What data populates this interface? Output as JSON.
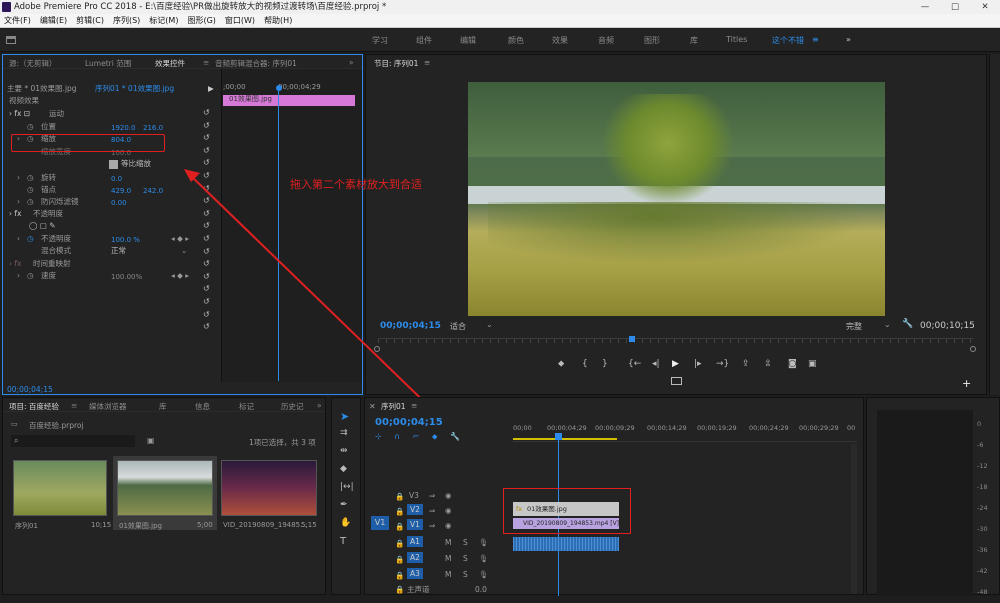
{
  "window": {
    "title": "Adobe Premiere Pro CC 2018 - E:\\百度经验\\PR做出旋转放大的视频过渡转场\\百度经验.prproj *",
    "controls": [
      "—",
      "□",
      "✕"
    ]
  },
  "menu": [
    "文件(F)",
    "编辑(E)",
    "剪辑(C)",
    "序列(S)",
    "标记(M)",
    "图形(G)",
    "窗口(W)",
    "帮助(H)"
  ],
  "workspaces": [
    "学习",
    "组件",
    "编辑",
    "颜色",
    "效果",
    "音频",
    "图形",
    "库",
    "Titles",
    "这个不错",
    "»"
  ],
  "effect_controls": {
    "tabs": [
      "源:（无剪辑）",
      "Lumetri 范围",
      "效果控件",
      "音频剪辑混合器: 序列01"
    ],
    "master": "主要 * 01效果图.jpg",
    "sequence_clip": "序列01 * 01效果图.jpg",
    "timecode_start": ";00;00",
    "timecode_mid": "00;00;04;29",
    "clip_name": "01效果图.jpg",
    "video_effects": "视频效果",
    "motion": "运动",
    "position": "位置",
    "pos_x": "1920.0",
    "pos_y": "216.0",
    "scale": "缩放",
    "scale_val": "804.0",
    "scale_width": "缩放宽度",
    "scale_width_val": "100.0",
    "uniform": "等比缩放",
    "rotation": "旋转",
    "rotation_val": "0.0",
    "anchor": "锚点",
    "anchor_x": "429.0",
    "anchor_y": "242.0",
    "flicker": "防闪烁滤镜",
    "flicker_val": "0.00",
    "opacity_group": "不透明度",
    "opacity": "不透明度",
    "opacity_val": "100.0 %",
    "blend": "混合模式",
    "blend_val": "正常",
    "time_remap": "时间重映射",
    "speed": "速度",
    "speed_val": "100.00%",
    "footer_tc": "00;00;04;15"
  },
  "annotation": {
    "text": "拖入第二个素材放大到合适"
  },
  "program": {
    "title": "节目: 序列01",
    "timecode": "00;00;04;15",
    "fit": "适合",
    "quality": "完整",
    "duration": "00;00;10;15"
  },
  "project": {
    "tabs": [
      "项目: 百度经验",
      "媒体浏览器",
      "库",
      "信息",
      "标记",
      "历史记"
    ],
    "file": "百度经验.prproj",
    "status": "1项已选择，共 3 项",
    "items": [
      {
        "name": "序列01",
        "dur": "10;15"
      },
      {
        "name": "01效果图.jpg",
        "dur": "5;00"
      },
      {
        "name": "VID_20190809_19485...",
        "dur": "5;15"
      }
    ]
  },
  "timeline": {
    "title": "序列01",
    "timecode": "00;00;04;15",
    "ruler": [
      "00;00",
      "00;00;04;29",
      "00;00;09;29",
      "00;00;14;29",
      "00;00;19;29",
      "00;00;24;29",
      "00;00;29;29",
      "00"
    ],
    "tracks": [
      "V3",
      "V2",
      "V1",
      "A1",
      "A2",
      "A3"
    ],
    "src_v": "V1",
    "master": "主声道",
    "master_val": "0.0",
    "clip_v2": "01效果图.jpg",
    "clip_v1": "VID_20190809_194853.mp4 [V]",
    "m": "M",
    "s": "S",
    "fx": "fx"
  },
  "meter": {
    "labels": [
      "0",
      "-6",
      "-12",
      "-18",
      "-24",
      "-30",
      "-36",
      "-42",
      "-48"
    ]
  }
}
